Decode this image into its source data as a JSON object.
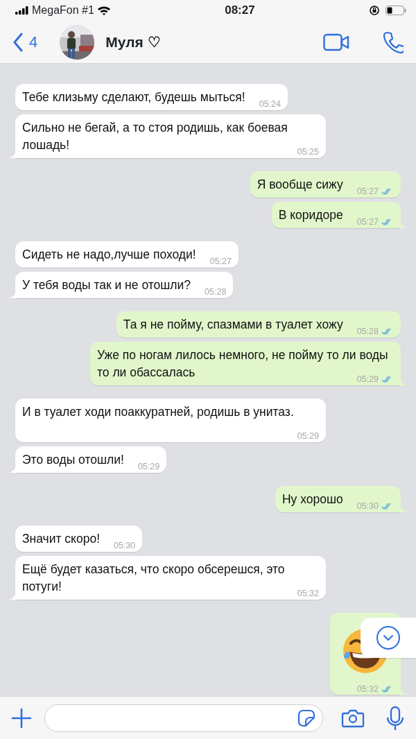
{
  "status_bar": {
    "carrier": "MegaFon #1",
    "time": "08:27"
  },
  "header": {
    "back_count": "4",
    "contact_name": "Муля ♡"
  },
  "messages": [
    {
      "outgoing": false,
      "kind": "text",
      "text": "Тебе клизьму сделают, будешь мыться!",
      "time": "05:24",
      "tail": false
    },
    {
      "outgoing": false,
      "kind": "text",
      "text": "Сильно не бегай, а то стоя родишь, как боевая лошадь!",
      "time": "05:25",
      "tail": true
    },
    {
      "outgoing": true,
      "kind": "text",
      "text": "Я вообще сижу",
      "time": "05:27",
      "tail": false,
      "read": true
    },
    {
      "outgoing": true,
      "kind": "text",
      "text": "В коридоре",
      "time": "05:27",
      "tail": true,
      "read": true
    },
    {
      "outgoing": false,
      "kind": "text",
      "text": "Сидеть не надо,лучше походи!",
      "time": "05:27",
      "tail": false
    },
    {
      "outgoing": false,
      "kind": "text",
      "text": "У тебя воды так и не отошли?",
      "time": "05:28",
      "tail": true
    },
    {
      "outgoing": true,
      "kind": "text",
      "text": "Та я не пойму, спазмами в туалет хожу",
      "time": "05:28",
      "tail": false,
      "read": true
    },
    {
      "outgoing": true,
      "kind": "text",
      "text": "Уже по ногам лилось немного, не пойму то ли воды то ли обассалась",
      "time": "05:29",
      "tail": true,
      "read": true
    },
    {
      "outgoing": false,
      "kind": "text",
      "text": "И в туалет ходи поаккуратней, родишь в унитаз.",
      "time": "05:29",
      "tail": false
    },
    {
      "outgoing": false,
      "kind": "text",
      "text": "Это воды отошли!",
      "time": "05:29",
      "tail": true
    },
    {
      "outgoing": true,
      "kind": "text",
      "text": "Ну хорошо",
      "time": "05:30",
      "tail": true,
      "read": true
    },
    {
      "outgoing": false,
      "kind": "text",
      "text": "Значит скоро!",
      "time": "05:30",
      "tail": false
    },
    {
      "outgoing": false,
      "kind": "text",
      "text": "Ещё будет казаться, что скоро обсерешся, это потуги!",
      "time": "05:32",
      "tail": true
    },
    {
      "outgoing": true,
      "kind": "emoji",
      "time": "05:32",
      "tail": true,
      "read": true
    }
  ]
}
